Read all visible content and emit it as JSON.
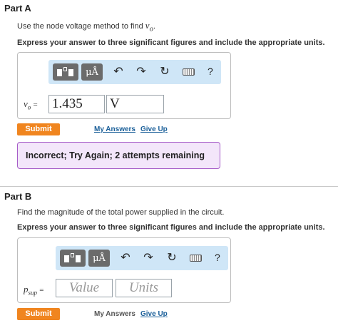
{
  "part_a": {
    "title": "Part A",
    "prompt_prefix": "Use the node voltage method to find ",
    "prompt_var": "v",
    "prompt_var_sub": "o",
    "prompt_suffix": ".",
    "instruction": "Express your answer to three significant figures and include the appropriate units.",
    "var_label": "v",
    "var_sub": "o",
    "equals": "=",
    "value": "1.435",
    "units": "V",
    "submit_label": "Submit",
    "my_answers_label": "My Answers",
    "give_up_label": "Give Up",
    "feedback": "Incorrect; Try Again; 2 attempts remaining"
  },
  "part_b": {
    "title": "Part B",
    "prompt": "Find the magnitude of the total power supplied in the circuit.",
    "instruction": "Express your answer to three significant figures and include the appropriate units.",
    "var_label": "p",
    "var_sub": "sup",
    "equals": "=",
    "value_placeholder": "Value",
    "units_placeholder": "Units",
    "submit_label": "Submit",
    "my_answers_label": "My Answers",
    "give_up_label": "Give Up"
  },
  "toolbar": {
    "units_glyph": "μÅ",
    "undo_glyph": "↶",
    "redo_glyph": "↷",
    "reset_glyph": "↻",
    "help_glyph": "?"
  },
  "colors": {
    "submit": "#f0851f",
    "toolbar_bg": "#cfe6f7",
    "feedback_bg": "#f3e6fa",
    "feedback_border": "#a65cc8",
    "link": "#1a5f99"
  }
}
